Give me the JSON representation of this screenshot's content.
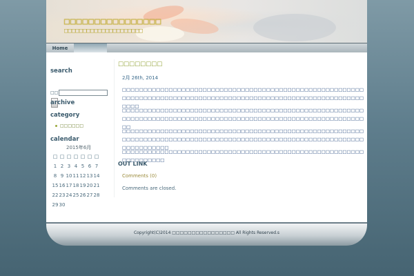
{
  "header": {
    "site_title": "□□□□□□□□□□□□□□□□",
    "site_description": "□□□□□□□□□□□□□□□□□□□□□"
  },
  "nav": {
    "home": "Home"
  },
  "sidebar": {
    "search_heading": "search",
    "search_label": "□□",
    "archive_heading": "archive",
    "category_heading": "category",
    "category_item": "□□□□□□",
    "calendar_heading": "calendar",
    "calendar_caption": "2015年6月",
    "calendar_weekdays": [
      "□",
      "□",
      "□",
      "□",
      "□",
      "□",
      "□"
    ],
    "calendar_rows": [
      [
        "1",
        "2",
        "3",
        "4",
        "5",
        "6",
        "7"
      ],
      [
        "8",
        "9",
        "10",
        "11",
        "12",
        "13",
        "14"
      ],
      [
        "15",
        "16",
        "17",
        "18",
        "19",
        "20",
        "21"
      ],
      [
        "22",
        "23",
        "24",
        "25",
        "26",
        "27",
        "28"
      ],
      [
        "29",
        "30",
        "",
        "",
        "",
        "",
        ""
      ]
    ]
  },
  "post": {
    "title": "□□□□□□□□",
    "date": "2月 26th, 2014",
    "paragraphs": [
      "□□□□□□□□□□□□□□□□□□□□□□□□□□□□□□□□□□□□□□□□□□□□□□□□□□□□□□□□□□□□□□□□□□□□□□□□□□□□□□□□□□□□□□□□□□□□□□□□□□□□□□□□□□□□□□□□□□□□□□",
      "□□□□□□□□□□□□□□□□□□□□□□□□□□□□□□□□□□□□□□□□□□□□□□□□□□□□□□□□□□□□□□□□□□□□□□□□□□□□□□□□□□□□□□□□□□□□□□□□□□□□□□□□□□□□□□□□□□□□",
      "□□□□□□□□□□□□□□□□□□□□□□□□□□□□□□□□□□□□□□□□□□□□□□□□□□□□□□□□□□□□□□□□□□□□□□□□□□□□□□□□□□□□□□□□□□□□□□□□□□□□□□□□□□□□□□□□□□□□□□□□□□□□□",
      "□□□□□□□□□□□□□□□□□□□□□□□□□□□□□□□□□□□□□□□□□□□□□□□□□□□□□□□□□□□□□□□□□□□"
    ],
    "out_link_heading": "OUT LINK",
    "comments_link": "Comments (0)",
    "comments_closed": "Comments are closed."
  },
  "footer": {
    "copyright": "Copyright(C)2014 □□□□□□□□□□□□□□□□ All Rights Reserved.s"
  }
}
